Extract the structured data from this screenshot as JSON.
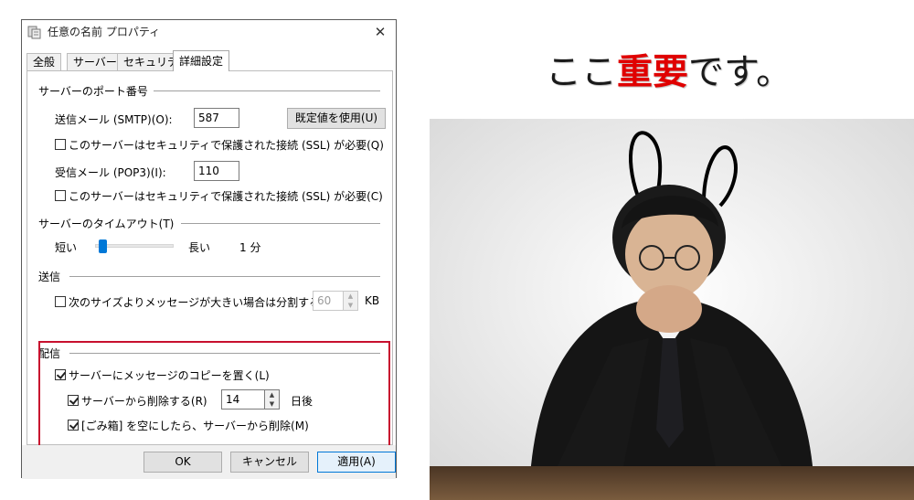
{
  "dialog": {
    "title": "任意の名前 プロパティ",
    "tabs": [
      "全般",
      "サーバー",
      "セキュリティ",
      "詳細設定"
    ],
    "active_tab": "詳細設定",
    "port_section": {
      "title": "サーバーのポート番号",
      "smtp_label": "送信メール (SMTP)(O):",
      "smtp_value": "587",
      "default_button": "既定値を使用(U)",
      "smtp_ssl_label": "このサーバーはセキュリティで保護された接続 (SSL) が必要(Q)",
      "pop3_label": "受信メール (POP3)(I):",
      "pop3_value": "110",
      "pop3_ssl_label": "このサーバーはセキュリティで保護された接続 (SSL) が必要(C)"
    },
    "timeout_section": {
      "title": "サーバーのタイムアウト(T)",
      "short_label": "短い",
      "long_label": "長い",
      "value_label": "1 分",
      "slider_fraction": 0.05
    },
    "send_section": {
      "title": "送信",
      "split_label": "次のサイズよりメッセージが大きい場合は分割する(B)",
      "split_value": "60",
      "unit": "KB"
    },
    "delivery_section": {
      "title": "配信",
      "leave_copy_label": "サーバーにメッセージのコピーを置く(L)",
      "remove_label": "サーバーから削除する(R)",
      "remove_days": "14",
      "days_unit": "日後",
      "remove_trash_label": "[ごみ箱] を空にしたら、サーバーから削除(M)"
    },
    "buttons": {
      "ok": "OK",
      "cancel": "キャンセル",
      "apply": "適用(A)"
    }
  },
  "headline": {
    "part1": "ここ",
    "highlight": "重要",
    "part2": "です。"
  },
  "colors": {
    "accent": "#0078d7",
    "highlight": "#c8102e",
    "headline_red": "#e00000"
  }
}
